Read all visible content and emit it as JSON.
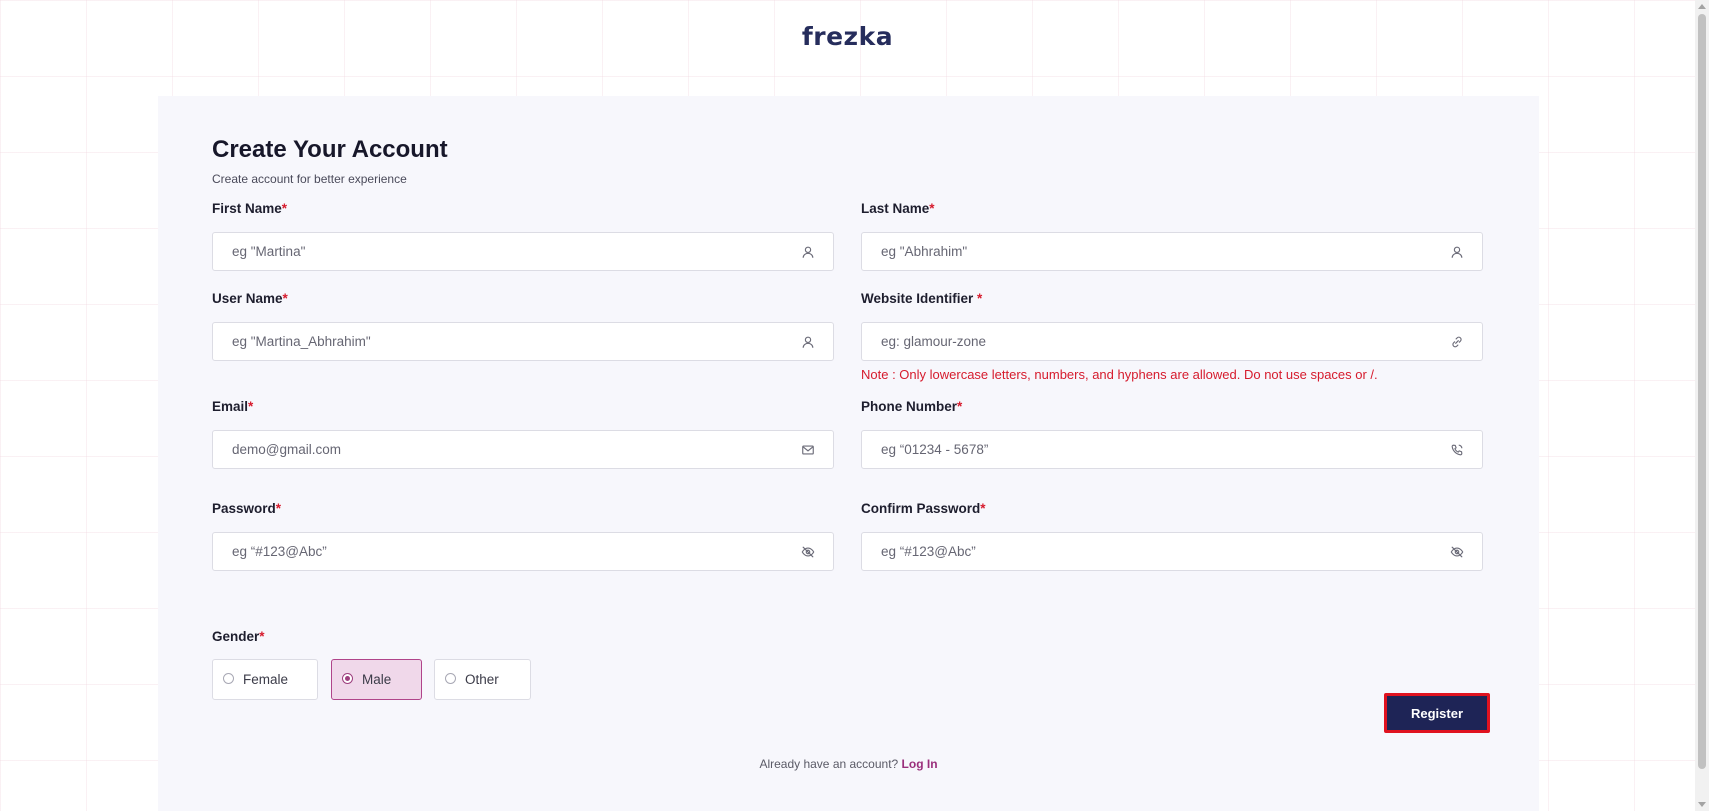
{
  "brand": {
    "logo_text": "frezka"
  },
  "header": {
    "title": "Create Your Account",
    "subtitle": "Create account for better experience"
  },
  "fields": {
    "first_name": {
      "label": "First Name",
      "required_mark": "*",
      "placeholder": "eg \"Martina\"",
      "value": "",
      "icon": "user-icon"
    },
    "last_name": {
      "label": "Last Name",
      "required_mark": "*",
      "placeholder": "eg \"Abhrahim\"",
      "value": "",
      "icon": "user-icon"
    },
    "user_name": {
      "label": "User Name",
      "required_mark": "*",
      "placeholder": "eg \"Martina_Abhrahim\"",
      "value": "",
      "icon": "user-icon"
    },
    "website_identifier": {
      "label": "Website Identifier ",
      "required_mark": "*",
      "placeholder": "eg: glamour-zone",
      "value": "",
      "icon": "link-icon",
      "note": "Note : Only lowercase letters, numbers, and hyphens are allowed. Do not use spaces or /."
    },
    "email": {
      "label": "Email",
      "required_mark": "*",
      "placeholder": "demo@gmail.com",
      "value": "",
      "icon": "mail-icon"
    },
    "phone": {
      "label": "Phone Number",
      "required_mark": "*",
      "placeholder": "eg “01234 - 5678”",
      "value": "",
      "icon": "phone-icon"
    },
    "password": {
      "label": "Password",
      "required_mark": "*",
      "placeholder": "eg “#123@Abc”",
      "value": "",
      "icon": "eye-off-icon"
    },
    "confirm_password": {
      "label": "Confirm Password",
      "required_mark": "*",
      "placeholder": "eg “#123@Abc”",
      "value": "",
      "icon": "eye-off-icon"
    }
  },
  "gender": {
    "label": "Gender",
    "required_mark": "*",
    "options": [
      "Female",
      "Male",
      "Other"
    ],
    "selected": "Male"
  },
  "actions": {
    "register_label": "Register"
  },
  "footer": {
    "login_prompt": "Already have an account?",
    "login_link": "Log In"
  },
  "colors": {
    "brand_navy": "#1e2456",
    "accent_magenta": "#9d3f7e",
    "required_red": "#d61b2d",
    "highlight_red": "#e0121f",
    "card_bg": "#f7f7fc"
  }
}
